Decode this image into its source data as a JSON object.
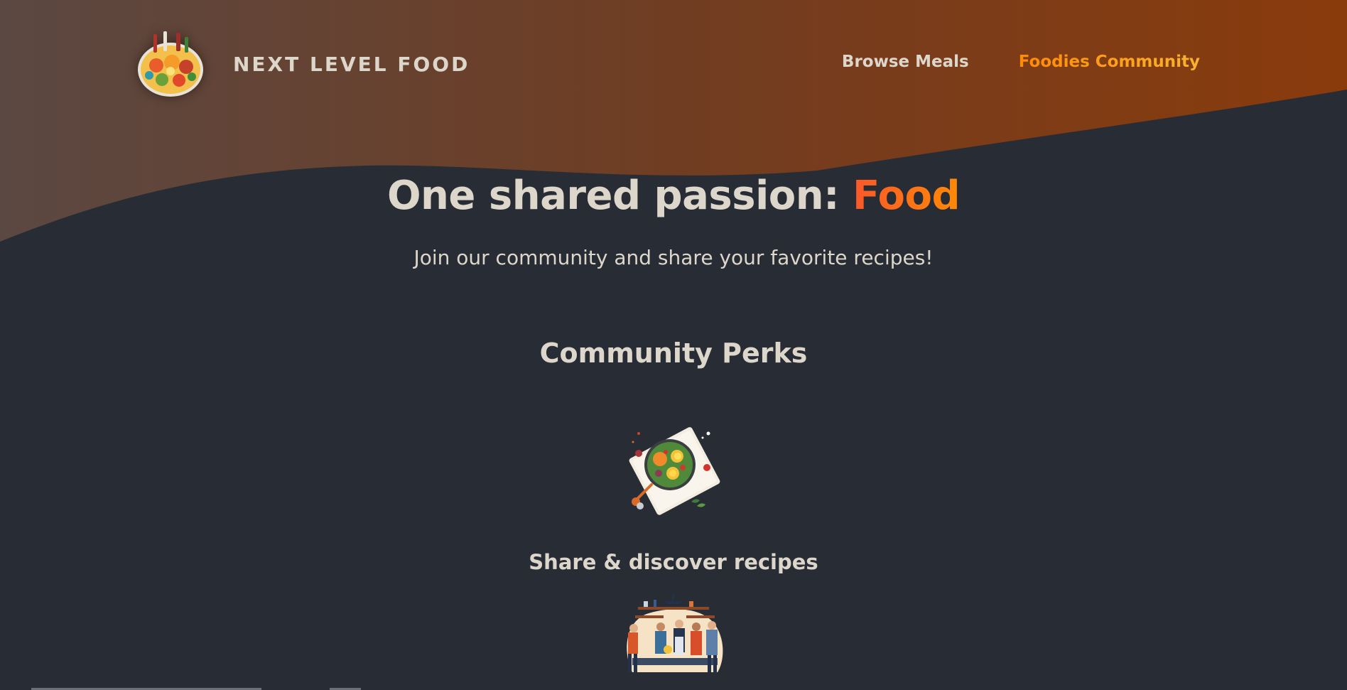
{
  "header": {
    "logo_alt": "A plate with food on it",
    "logo_text": "NEXT LEVEL FOOD",
    "nav": {
      "browse_meals": "Browse Meals",
      "foodies_community": "Foodies Community"
    }
  },
  "hero": {
    "title_prefix": "One shared passion: ",
    "title_highlight": "Food",
    "subtitle": "Join our community and share your favorite recipes!"
  },
  "perks": {
    "title": "Community Perks",
    "items": [
      {
        "label": "Share & discover recipes",
        "icon": "meal-plate-illustration"
      },
      {
        "label": "",
        "icon": "community-kitchen-illustration"
      }
    ]
  },
  "colors": {
    "background": "#282c34",
    "header_gradient_start": "#5b4c48",
    "header_gradient_end": "#8a3c0d",
    "text": "#ddd6cb",
    "accent_start": "#f9572a",
    "accent_end": "#ff8a05"
  }
}
